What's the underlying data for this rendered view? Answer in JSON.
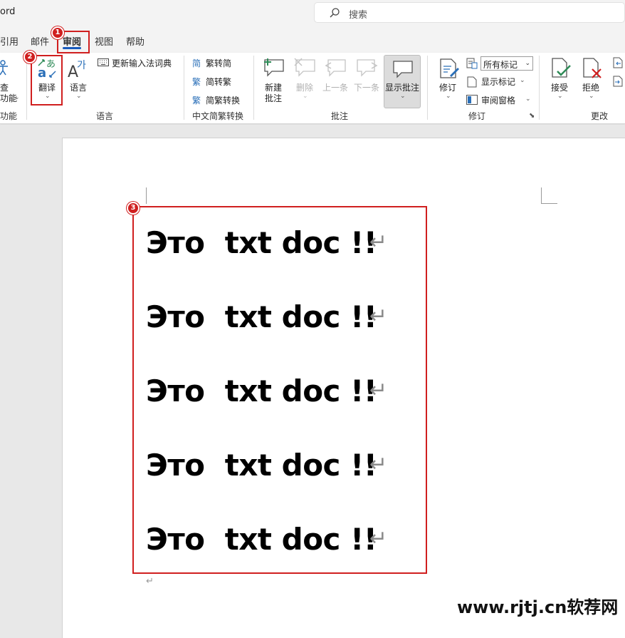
{
  "window": {
    "title": "ord",
    "search_placeholder": "搜索"
  },
  "tabs": [
    {
      "label": "引用"
    },
    {
      "label": "邮件"
    },
    {
      "label": "审阅",
      "active": true
    },
    {
      "label": "视图"
    },
    {
      "label": "帮助"
    }
  ],
  "ribbon": {
    "accessibility": {
      "label_top": "查",
      "label_bottom": "功能",
      "group": "功能"
    },
    "language": {
      "translate": "翻译",
      "language": "语言",
      "update_ime": "更新输入法词典",
      "group": "语言"
    },
    "chinese_conversion": {
      "trad_to_simp": "繁转简",
      "simp_to_trad": "简转繁",
      "conversion": "简繁转换",
      "group": "中文简繁转换"
    },
    "comments": {
      "new_line1": "新建",
      "new_line2": "批注",
      "delete": "删除",
      "previous": "上一条",
      "next": "下一条",
      "show": "显示批注",
      "group": "批注"
    },
    "tracking": {
      "track_changes": "修订",
      "markup_combo": "所有标记",
      "show_markup": "显示标记",
      "review_pane": "审阅窗格",
      "group": "修订"
    },
    "changes": {
      "accept": "接受",
      "reject": "拒绝",
      "group": "更改"
    }
  },
  "document": {
    "lines": [
      "Это  txt doc !!",
      "Это  txt doc !!",
      "Это  txt doc !!",
      "Это  txt doc !!",
      "Это  txt doc !!"
    ],
    "paragraph_mark": "↵"
  },
  "annotations": {
    "badge1": "1",
    "badge2": "2",
    "badge3": "3",
    "color": "#d01f1f"
  },
  "watermark": "www.rjtj.cn软荐网",
  "colors": {
    "accent": "#185abd",
    "ribbon_bg": "#ffffff",
    "chrome_bg": "#f3f3f3"
  }
}
